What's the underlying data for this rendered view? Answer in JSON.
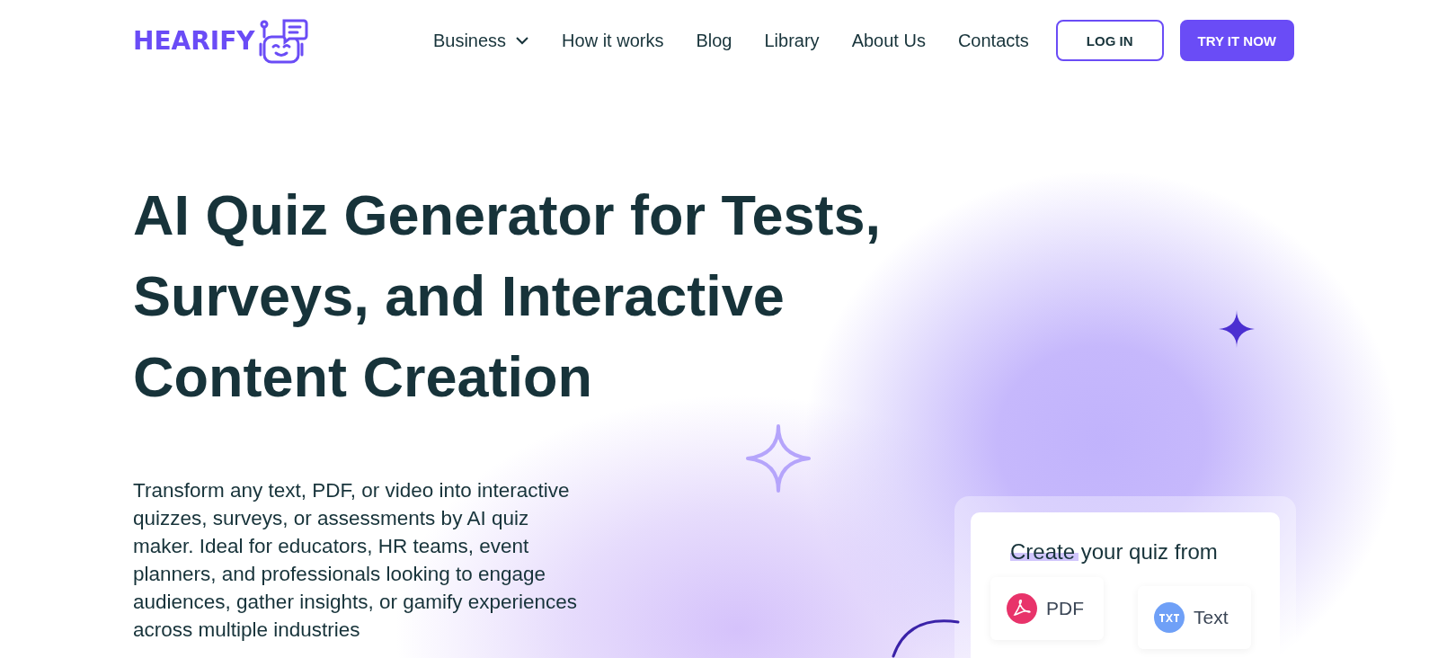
{
  "logo": {
    "text": "HEARIFY"
  },
  "nav": [
    {
      "label": "Business",
      "kind": "dropdown"
    },
    {
      "label": "How it works",
      "kind": "link"
    },
    {
      "label": "Blog",
      "kind": "link"
    },
    {
      "label": "Library",
      "kind": "link"
    },
    {
      "label": "About Us",
      "kind": "link"
    },
    {
      "label": "Contacts",
      "kind": "link"
    }
  ],
  "buttons": [
    {
      "label": "LOG IN",
      "kind": "outline"
    },
    {
      "label": "TRY IT NOW",
      "kind": "filled"
    }
  ],
  "hero": {
    "title": "AI Quiz Generator for Tests, Surveys, and Interactive Content Creation",
    "description": "Transform any text, PDF, or video into interactive quizzes, surveys, or assessments by AI quiz maker. Ideal for educators, HR teams, event planners, and professionals looking to engage audiences, gather insights, or gamify experiences across multiple industries"
  },
  "quiz_card": {
    "title": "Create your quiz from",
    "sources": [
      {
        "label": "PDF",
        "kind": "pdf"
      },
      {
        "label": "Text",
        "kind": "txt"
      }
    ]
  }
}
